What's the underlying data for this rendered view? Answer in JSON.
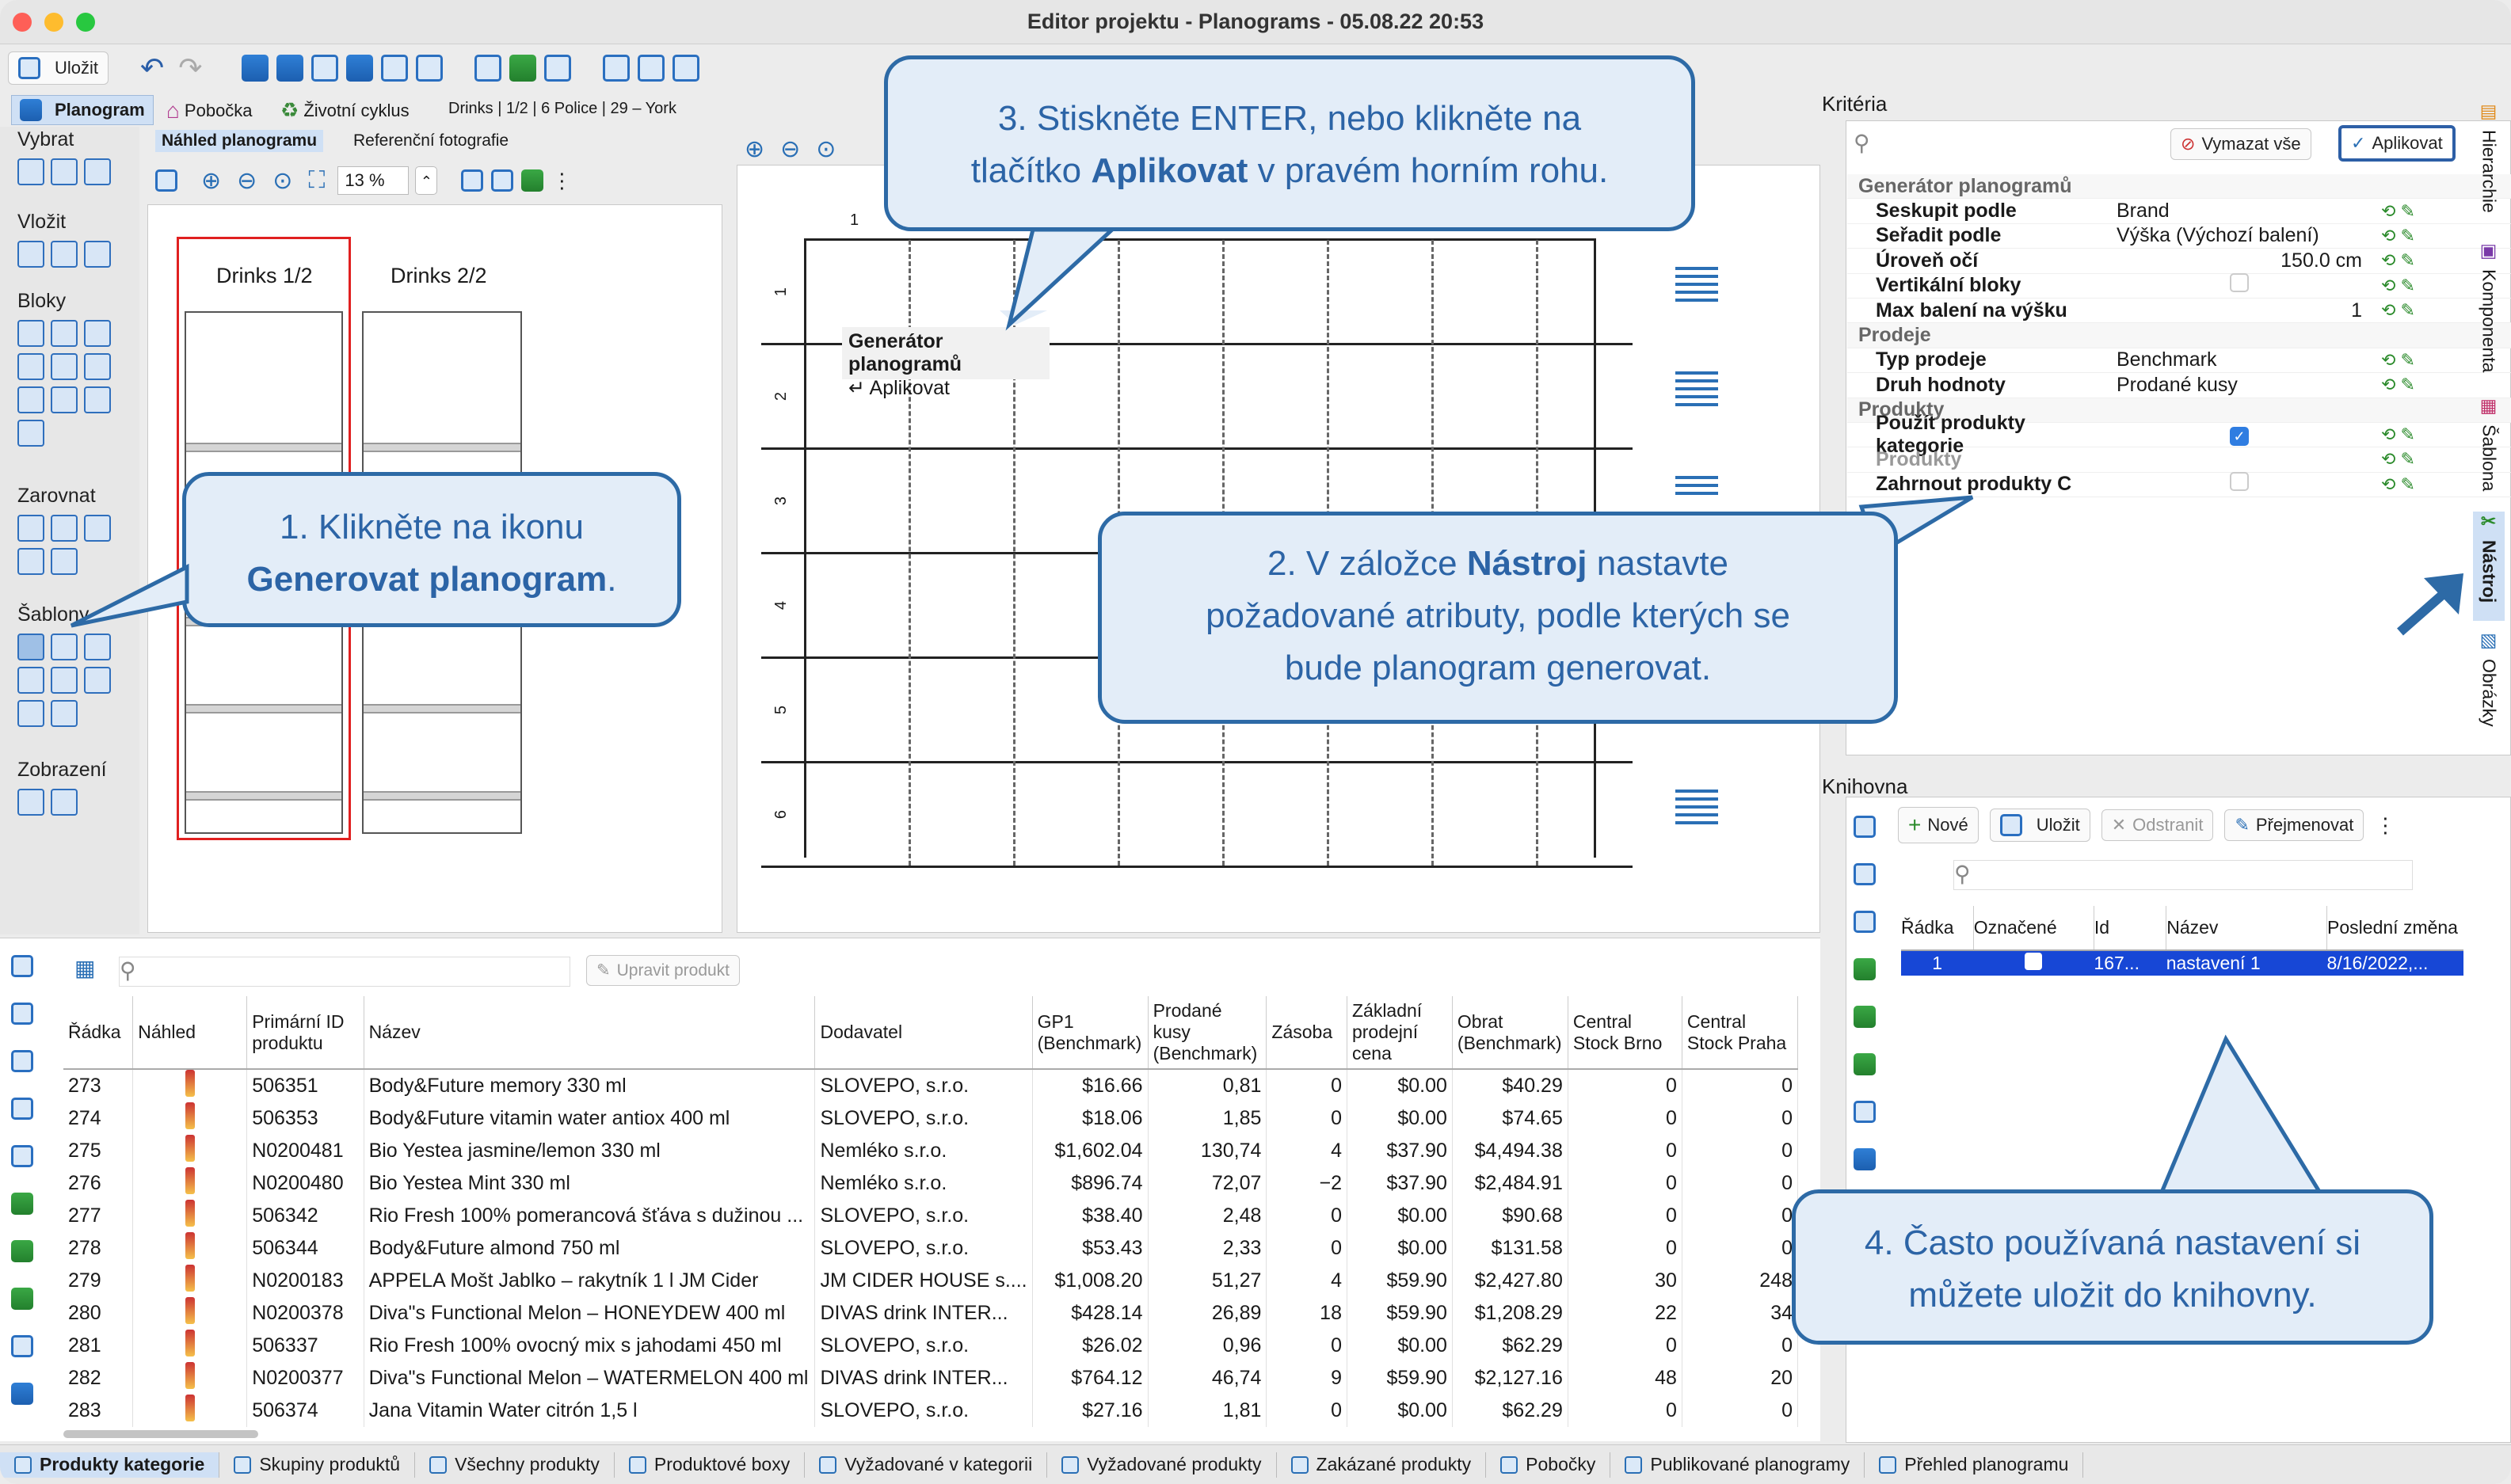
{
  "window": {
    "title": "Editor projektu - Planograms - 05.08.22 20:53"
  },
  "toolbar": {
    "save": "Uložit"
  },
  "tabs": {
    "planogram": "Planogram",
    "branch": "Pobočka",
    "lifecycle": "Životní cyklus",
    "breadcrumb": "Drinks | 1/2 | 6 Police | 29 – York"
  },
  "subtabs": {
    "preview": "Náhled planogramu",
    "photos": "Referenční fotografie"
  },
  "zoom": {
    "value": "13 %"
  },
  "sidebar": {
    "groups": [
      "Vybrat",
      "Vložit",
      "Bloky",
      "Zarovnat",
      "Šablony",
      "Zobrazení"
    ]
  },
  "preview": {
    "sections": [
      "Drinks 1/2",
      "Drinks 2/2"
    ]
  },
  "editor": {
    "top_label": "1",
    "rows": [
      "1",
      "2",
      "3",
      "4",
      "5",
      "6"
    ],
    "tooltip_title": "Generátor planogramů",
    "tooltip_action": "↵ Aplikovat"
  },
  "callouts": {
    "c1_pre": "1. Klikněte na ikonu",
    "c1_b": "Generovat planogram",
    "c1_post": ".",
    "c2_pre": "2. V záložce ",
    "c2_b": "Nástroj",
    "c2_post": " nastavte",
    "c2_l2": "požadované atributy, podle kterých se",
    "c2_l3": "bude planogram generovat.",
    "c3_l1": "3. Stiskněte ENTER, nebo klikněte na",
    "c3_pre": "tlačítko ",
    "c3_b": "Aplikovat",
    "c3_post": " v pravém horním rohu.",
    "c4_l1": "4. Často používaná nastavení si",
    "c4_l2": "můžete uložit do knihovny."
  },
  "criteria": {
    "title": "Kritéria",
    "clear": "Vymazat vše",
    "apply": "Aplikovat",
    "rows": [
      {
        "type": "section",
        "label": "Generátor planogramů"
      },
      {
        "type": "row",
        "key": "Seskupit podle",
        "value": "Brand"
      },
      {
        "type": "row",
        "key": "Seřadit podle",
        "value": "Výška (Výchozí balení)"
      },
      {
        "type": "row",
        "key": "Úroveň očí",
        "value": "150.0 cm"
      },
      {
        "type": "check",
        "key": "Vertikální bloky",
        "checked": false
      },
      {
        "type": "row",
        "key": "Max balení na výšku",
        "value": "1"
      },
      {
        "type": "section",
        "label": "Prodeje"
      },
      {
        "type": "row",
        "key": "Typ prodeje",
        "value": "Benchmark"
      },
      {
        "type": "row",
        "key": "Druh hodnoty",
        "value": "Prodané kusy"
      },
      {
        "type": "section",
        "label": "Produkty"
      },
      {
        "type": "check",
        "key": "Použít produkty kategorie",
        "checked": true
      },
      {
        "type": "muted",
        "key": "Produkty",
        "value": ""
      },
      {
        "type": "check",
        "key": "Zahrnout produkty C",
        "checked": false
      }
    ]
  },
  "library": {
    "title": "Knihovna",
    "new": "Nové",
    "save": "Uložit",
    "remove": "Odstranit",
    "rename": "Přejmenovat",
    "headers": [
      "Řádka",
      "Označené",
      "Id",
      "Název",
      "Poslední změna"
    ],
    "row": [
      "1",
      "",
      "167...",
      "nastavení 1",
      "8/16/2022,..."
    ]
  },
  "products": {
    "edit": "Upravit produkt",
    "headers": [
      "Řádka",
      "Náhled",
      "Primární ID produktu",
      "Název",
      "Dodavatel",
      "GP1 (Benchmark)",
      "Prodané kusy (Benchmark)",
      "Zásoba",
      "Základní prodejní cena",
      "Obrat (Benchmark)",
      "Central Stock Brno",
      "Central Stock Praha"
    ],
    "rows": [
      [
        "273",
        "",
        "506351",
        "Body&Future memory 330 ml",
        "SLOVEPO, s.r.o.",
        "$16.66",
        "0,81",
        "0",
        "$0.00",
        "$40.29",
        "0",
        "0"
      ],
      [
        "274",
        "",
        "506353",
        "Body&Future vitamin water antiox 400 ml",
        "SLOVEPO, s.r.o.",
        "$18.06",
        "1,85",
        "0",
        "$0.00",
        "$74.65",
        "0",
        "0"
      ],
      [
        "275",
        "",
        "N0200481",
        "Bio Yestea jasmine/lemon 330 ml",
        "Nemléko s.r.o.",
        "$1,602.04",
        "130,74",
        "4",
        "$37.90",
        "$4,494.38",
        "0",
        "0"
      ],
      [
        "276",
        "",
        "N0200480",
        "Bio Yestea Mint 330 ml",
        "Nemléko s.r.o.",
        "$896.74",
        "72,07",
        "−2",
        "$37.90",
        "$2,484.91",
        "0",
        "0"
      ],
      [
        "277",
        "",
        "506342",
        "Rio Fresh 100% pomerancová šťáva s dužinou ...",
        "SLOVEPO, s.r.o.",
        "$38.40",
        "2,48",
        "0",
        "$0.00",
        "$90.68",
        "0",
        "0"
      ],
      [
        "278",
        "",
        "506344",
        "Body&Future almond 750 ml",
        "SLOVEPO, s.r.o.",
        "$53.43",
        "2,33",
        "0",
        "$0.00",
        "$131.58",
        "0",
        "0"
      ],
      [
        "279",
        "",
        "N0200183",
        "APPELA  Mošt Jablko – rakytník 1 l JM Cider",
        "JM CIDER HOUSE s....",
        "$1,008.20",
        "51,27",
        "4",
        "$59.90",
        "$2,427.80",
        "30",
        "248"
      ],
      [
        "280",
        "",
        "N0200378",
        "Diva\"s Functional Melon – HONEYDEW 400 ml",
        "DIVAS drink INTER...",
        "$428.14",
        "26,89",
        "18",
        "$59.90",
        "$1,208.29",
        "22",
        "34"
      ],
      [
        "281",
        "",
        "506337",
        "Rio Fresh 100% ovocný mix s jahodami 450 ml",
        "SLOVEPO, s.r.o.",
        "$26.02",
        "0,96",
        "0",
        "$0.00",
        "$62.29",
        "0",
        "0"
      ],
      [
        "282",
        "",
        "N0200377",
        "Diva\"s Functional Melon – WATERMELON 400 ml",
        "DIVAS drink INTER...",
        "$764.12",
        "46,74",
        "9",
        "$59.90",
        "$2,127.16",
        "48",
        "20"
      ],
      [
        "283",
        "",
        "506374",
        "Jana Vitamin Water citrón 1,5 l",
        "SLOVEPO, s.r.o.",
        "$27.16",
        "1,81",
        "0",
        "$0.00",
        "$62.29",
        "0",
        "0"
      ]
    ]
  },
  "right_tabs": [
    "Hierarchie",
    "Komponenta",
    "Šablona",
    "Nástroj",
    "Obrázky"
  ],
  "bottom_tabs": [
    "Produkty kategorie",
    "Skupiny produktů",
    "Všechny produkty",
    "Produktové boxy",
    "Vyžadované v kategorii",
    "Vyžadované produkty",
    "Zakázané produkty",
    "Pobočky",
    "Publikované planogramy",
    "Přehled planogramu"
  ]
}
